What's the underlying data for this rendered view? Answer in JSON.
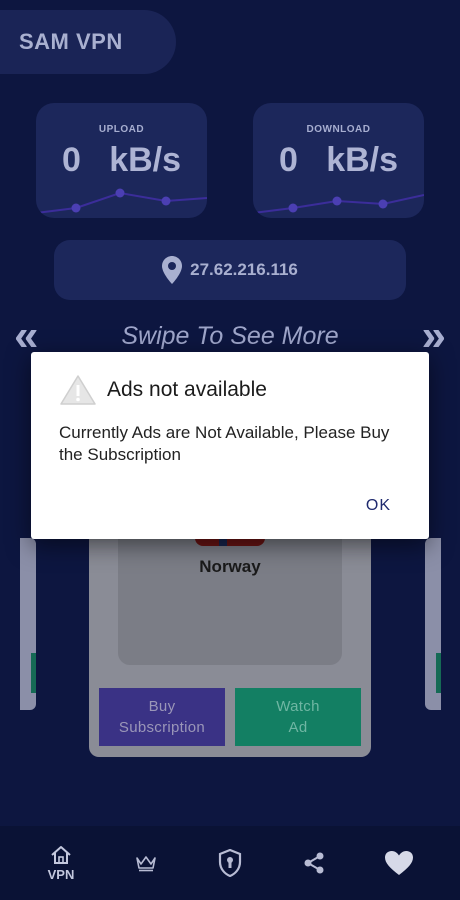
{
  "app": {
    "title": "SAM VPN"
  },
  "speed": {
    "upload": {
      "label": "UPLOAD",
      "value": "0   kB/s"
    },
    "download": {
      "label": "DOWNLOAD",
      "value": "0   kB/s"
    }
  },
  "ip": {
    "address": "27.62.216.116",
    "icon": "location-pin-icon"
  },
  "swipe": {
    "text": "Swipe To See More",
    "left_icon": "«",
    "right_icon": "»"
  },
  "server": {
    "country": "Norway",
    "buy_label_line1": "Buy",
    "buy_label_line2": "Subscription",
    "watch_label_line1": "Watch",
    "watch_label_line2": "Ad"
  },
  "dialog": {
    "title": "Ads not available",
    "message": "Currently Ads are Not Available, Please Buy the Subscription",
    "ok_label": "OK"
  },
  "nav": {
    "items": [
      {
        "label": "VPN",
        "icon": "home-icon"
      },
      {
        "label": "",
        "icon": "crown-icon"
      },
      {
        "label": "",
        "icon": "shield-lock-icon"
      },
      {
        "label": "",
        "icon": "share-icon"
      },
      {
        "label": "",
        "icon": "heart-icon"
      }
    ]
  },
  "colors": {
    "background": "#0d1640",
    "card": "#1c275b",
    "graph": "#3b2d9a",
    "buy_button": "#3a3285",
    "watch_button": "#137f63"
  }
}
